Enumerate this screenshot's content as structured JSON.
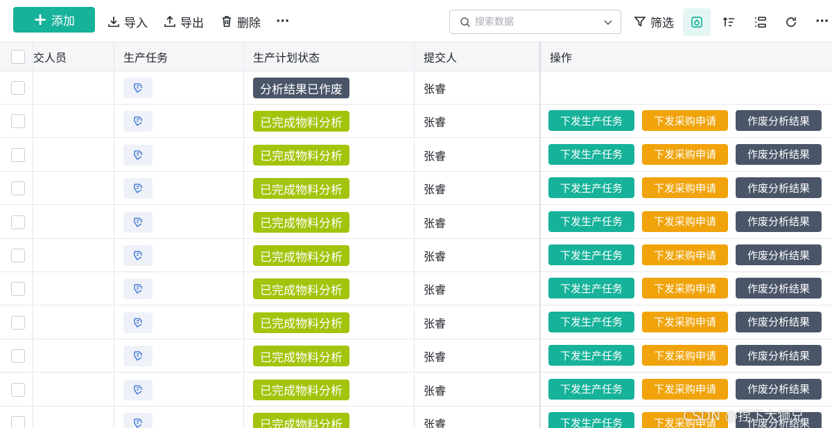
{
  "toolbar": {
    "add_label": "添加",
    "import_label": "导入",
    "export_label": "导出",
    "delete_label": "删除",
    "more_label": "···",
    "search_placeholder": "搜索数据",
    "filter_label": "筛选",
    "more2_label": "···"
  },
  "table": {
    "columns": [
      "交人员",
      "生产任务",
      "生产计划状态",
      "提交人",
      "操作"
    ],
    "rows": [
      {
        "status": "分析结果已作废",
        "status_color": "#4a5568",
        "submitter": "张睿",
        "ops": []
      },
      {
        "status": "已完成物料分析",
        "status_color": "#a3c40c",
        "submitter": "张睿",
        "ops": [
          "下发生产任务",
          "下发采购申请",
          "作废分析结果"
        ]
      },
      {
        "status": "已完成物料分析",
        "status_color": "#a3c40c",
        "submitter": "张睿",
        "ops": [
          "下发生产任务",
          "下发采购申请",
          "作废分析结果"
        ]
      },
      {
        "status": "已完成物料分析",
        "status_color": "#a3c40c",
        "submitter": "张睿",
        "ops": [
          "下发生产任务",
          "下发采购申请",
          "作废分析结果"
        ]
      },
      {
        "status": "已完成物料分析",
        "status_color": "#a3c40c",
        "submitter": "张睿",
        "ops": [
          "下发生产任务",
          "下发采购申请",
          "作废分析结果"
        ]
      },
      {
        "status": "已完成物料分析",
        "status_color": "#a3c40c",
        "submitter": "张睿",
        "ops": [
          "下发生产任务",
          "下发采购申请",
          "作废分析结果"
        ]
      },
      {
        "status": "已完成物料分析",
        "status_color": "#a3c40c",
        "submitter": "张睿",
        "ops": [
          "下发生产任务",
          "下发采购申请",
          "作废分析结果"
        ]
      },
      {
        "status": "已完成物料分析",
        "status_color": "#a3c40c",
        "submitter": "张睿",
        "ops": [
          "下发生产任务",
          "下发采购申请",
          "作废分析结果"
        ]
      },
      {
        "status": "已完成物料分析",
        "status_color": "#a3c40c",
        "submitter": "张睿",
        "ops": [
          "下发生产任务",
          "下发采购申请",
          "作废分析结果"
        ]
      },
      {
        "status": "已完成物料分析",
        "status_color": "#a3c40c",
        "submitter": "张睿",
        "ops": [
          "下发生产任务",
          "下发采购申请",
          "作废分析结果"
        ]
      },
      {
        "status": "已完成物料分析",
        "status_color": "#a3c40c",
        "submitter": "张睿",
        "ops": [
          "下发生产任务",
          "下发采购申请",
          "作废分析结果"
        ]
      }
    ],
    "op_colors": [
      "#16b29a",
      "#f0a30a",
      "#4a5568"
    ]
  },
  "watermark": "CSDN @捏下大狮兄",
  "colors": {
    "accent": "#16b29a",
    "warning": "#f0a30a",
    "dark": "#4a5568",
    "success": "#a3c40c"
  }
}
